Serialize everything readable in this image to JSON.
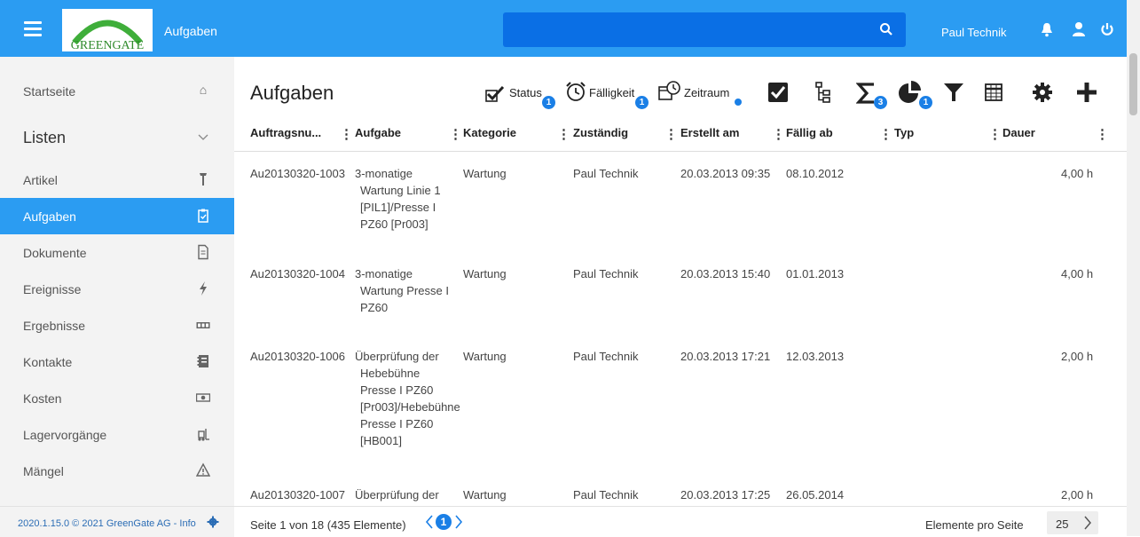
{
  "header": {
    "app_title": "Aufgaben",
    "logo_text": "GREENGATE",
    "search": {
      "value": "",
      "placeholder": ""
    },
    "user_name": "Paul Technik"
  },
  "sidebar": {
    "items": [
      {
        "label": "Startseite",
        "icon": "home-icon"
      },
      {
        "label": "Listen",
        "icon": "chevron-down-icon"
      },
      {
        "label": "Artikel",
        "icon": "wrench-icon"
      },
      {
        "label": "Aufgaben",
        "icon": "clipboard-icon",
        "active": true
      },
      {
        "label": "Dokumente",
        "icon": "document-icon"
      },
      {
        "label": "Ereignisse",
        "icon": "lightning-icon"
      },
      {
        "label": "Ergebnisse",
        "icon": "counter-icon"
      },
      {
        "label": "Kontakte",
        "icon": "address-book-icon"
      },
      {
        "label": "Kosten",
        "icon": "money-icon"
      },
      {
        "label": "Lagervorgänge",
        "icon": "forklift-icon"
      },
      {
        "label": "Mängel",
        "icon": "warning-icon"
      }
    ],
    "version": "2020.1.15.0 © 2021 GreenGate AG - Info"
  },
  "main": {
    "title": "Aufgaben",
    "toolbar": {
      "status_label": "Status",
      "status_badge": "1",
      "faelligkeit_label": "Fälligkeit",
      "faelligkeit_badge": "1",
      "zeitraum_label": "Zeitraum",
      "sum_badge": "3",
      "chart_badge": "1"
    },
    "columns": [
      "Auftragsnu...",
      "Aufgabe",
      "Kategorie",
      "Zuständig",
      "Erstellt am",
      "Fällig ab",
      "Typ",
      "Dauer"
    ],
    "rows": [
      {
        "nr": "Au20130320-1003",
        "aufgabe": [
          "3-monatige",
          "Wartung Linie 1",
          "[PIL1]/Presse I",
          "PZ60 [Pr003]"
        ],
        "kategorie": "Wartung",
        "zustaendig": "Paul Technik",
        "erstellt": "20.03.2013 09:35",
        "faellig": "08.10.2012",
        "typ": "",
        "dauer": "4,00 h"
      },
      {
        "nr": "Au20130320-1004",
        "aufgabe": [
          "3-monatige",
          "Wartung Presse I",
          "PZ60"
        ],
        "kategorie": "Wartung",
        "zustaendig": "Paul Technik",
        "erstellt": "20.03.2013 15:40",
        "faellig": "01.01.2013",
        "typ": "",
        "dauer": "4,00 h"
      },
      {
        "nr": "Au20130320-1006",
        "aufgabe": [
          "Überprüfung der",
          "Hebebühne",
          "Presse I PZ60",
          "[Pr003]/Hebebühne",
          "Presse I PZ60",
          "[HB001]"
        ],
        "kategorie": "Wartung",
        "zustaendig": "Paul Technik",
        "erstellt": "20.03.2013 17:21",
        "faellig": "12.03.2013",
        "typ": "",
        "dauer": "2,00 h"
      },
      {
        "nr": "Au20130320-1007",
        "aufgabe": [
          "Überprüfung der"
        ],
        "kategorie": "Wartung",
        "zustaendig": "Paul Technik",
        "erstellt": "20.03.2013 17:25",
        "faellig": "26.05.2014",
        "typ": "",
        "dauer": "2,00 h"
      }
    ]
  },
  "footer": {
    "page_info": "Seite 1 von 18 (435 Elemente)",
    "current_page": "1",
    "per_page_label": "Elemente pro Seite",
    "per_page_value": "25"
  },
  "colors": {
    "primary": "#2b9cf2",
    "search": "#0a6fe5",
    "badge": "#1a7fe6",
    "sidebar_bg": "#f3f3f3"
  }
}
